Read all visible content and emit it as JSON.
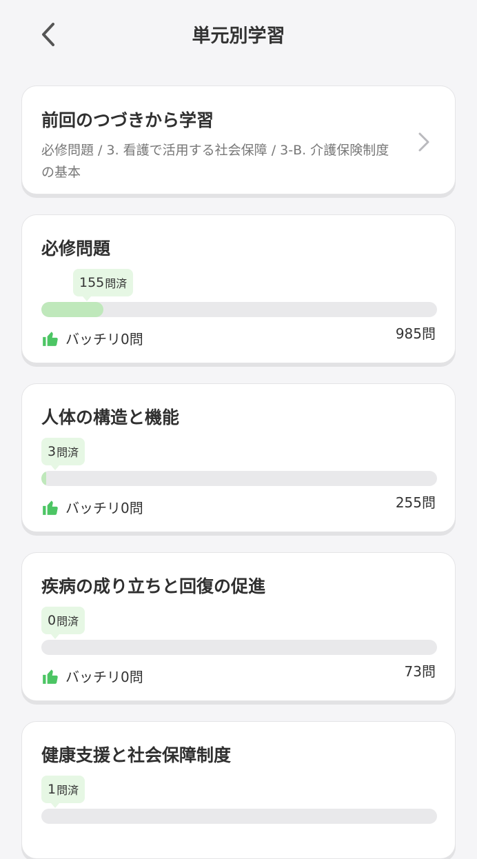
{
  "header": {
    "title": "単元別学習"
  },
  "resume": {
    "title": "前回のつづきから学習",
    "path": "必修問題 / 3. 看護で活用する社会保障 / 3-B. 介護保険制度の基本"
  },
  "colors": {
    "accent_green": "#4cc564",
    "fill_green": "#bfe8bb",
    "badge_bg": "#e6f7e4"
  },
  "icons": {
    "back": "chevron-left-icon",
    "forward": "chevron-right-icon",
    "perfect": "thumbs-up-icon"
  },
  "subjects": [
    {
      "title": "必修問題",
      "done_count": "155",
      "done_unit": "問済",
      "perfect_label": "バッチリ0問",
      "total": "985問",
      "progress": 0.157
    },
    {
      "title": "人体の構造と機能",
      "done_count": "3",
      "done_unit": "問済",
      "perfect_label": "バッチリ0問",
      "total": "255問",
      "progress": 0.012
    },
    {
      "title": "疾病の成り立ちと回復の促進",
      "done_count": "0",
      "done_unit": "問済",
      "perfect_label": "バッチリ0問",
      "total": "73問",
      "progress": 0
    },
    {
      "title": "健康支援と社会保障制度",
      "done_count": "1",
      "done_unit": "問済",
      "perfect_label": "",
      "total": "",
      "progress": 0
    }
  ]
}
